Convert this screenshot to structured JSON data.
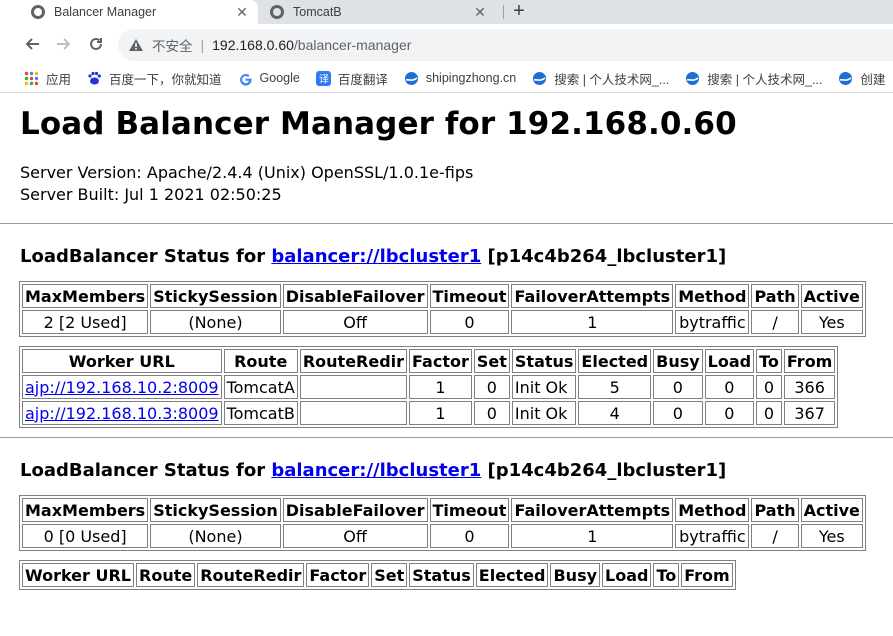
{
  "browser": {
    "tabs": [
      {
        "title": "Balancer Manager",
        "active": true
      },
      {
        "title": "TomcatB",
        "active": false
      }
    ],
    "new_tab": "+",
    "security_label": "不安全",
    "url_host": "192.168.0.60",
    "url_path": "/balancer-manager",
    "bookmarks": [
      {
        "label": "应用",
        "icon": "apps-grid-icon"
      },
      {
        "label": "百度一下，你就知道",
        "icon": "baidu-icon"
      },
      {
        "label": "Google",
        "icon": "google-icon"
      },
      {
        "label": "百度翻译",
        "icon": "translate-icon"
      },
      {
        "label": "shipingzhong.cn",
        "icon": "globe-icon"
      },
      {
        "label": "搜索 | 个人技术网_...",
        "icon": "globe-icon"
      },
      {
        "label": "搜索 | 个人技术网_...",
        "icon": "globe-icon"
      },
      {
        "label": "创建",
        "icon": "globe-icon"
      }
    ]
  },
  "page": {
    "title": "Load Balancer Manager for 192.168.0.60",
    "server_version": "Server Version: Apache/2.4.4 (Unix) OpenSSL/1.0.1e-fips",
    "server_built": "Server Built: Jul 1 2021 02:50:25",
    "balancers": [
      {
        "heading_prefix": "LoadBalancer Status for ",
        "link": "balancer://lbcluster1",
        "heading_suffix": " [p14c4b264_lbcluster1]",
        "status_headers": [
          "MaxMembers",
          "StickySession",
          "DisableFailover",
          "Timeout",
          "FailoverAttempts",
          "Method",
          "Path",
          "Active"
        ],
        "status_values": [
          "2 [2 Used]",
          "(None)",
          "Off",
          "0",
          "1",
          "bytraffic",
          "/",
          "Yes"
        ],
        "worker_headers": [
          "Worker URL",
          "Route",
          "RouteRedir",
          "Factor",
          "Set",
          "Status",
          "Elected",
          "Busy",
          "Load",
          "To",
          "From"
        ],
        "workers": [
          [
            "ajp://192.168.10.2:8009",
            "TomcatA",
            "",
            "1",
            "0",
            "Init Ok",
            "5",
            "0",
            "0",
            "0",
            "366"
          ],
          [
            "ajp://192.168.10.3:8009",
            "TomcatB",
            "",
            "1",
            "0",
            "Init Ok",
            "4",
            "0",
            "0",
            "0",
            "367"
          ]
        ]
      },
      {
        "heading_prefix": "LoadBalancer Status for ",
        "link": "balancer://lbcluster1",
        "heading_suffix": " [p14c4b264_lbcluster1]",
        "status_headers": [
          "MaxMembers",
          "StickySession",
          "DisableFailover",
          "Timeout",
          "FailoverAttempts",
          "Method",
          "Path",
          "Active"
        ],
        "status_values": [
          "0 [0 Used]",
          "(None)",
          "Off",
          "0",
          "1",
          "bytraffic",
          "/",
          "Yes"
        ],
        "worker_headers": [
          "Worker URL",
          "Route",
          "RouteRedir",
          "Factor",
          "Set",
          "Status",
          "Elected",
          "Busy",
          "Load",
          "To",
          "From"
        ],
        "workers": []
      }
    ]
  }
}
